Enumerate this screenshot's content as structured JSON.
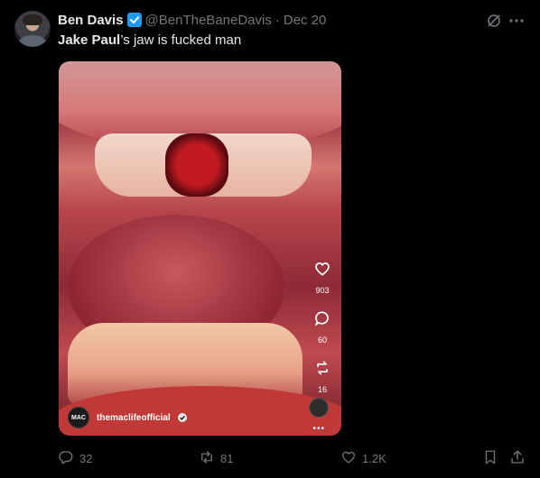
{
  "tweet": {
    "author_name": "Ben Davis",
    "handle": "@BenTheBaneDavis",
    "separator": "·",
    "date": "Dec 20",
    "mention": "Jake Paul",
    "text_rest": "’s jaw is fucked man"
  },
  "media": {
    "likes": "903",
    "comments": "60",
    "reposts": "16",
    "creator": "themaclifeofficial",
    "creator_logo": "MAC",
    "more": "•••"
  },
  "actions": {
    "replies": "32",
    "reposts": "81",
    "likes": "1.2K"
  },
  "colors": {
    "background": "#000000",
    "text": "#e7e9ea",
    "muted": "#71767b",
    "verified": "#1d9bf0"
  },
  "icons": [
    "grok-icon",
    "more-icon",
    "verified-icon",
    "heart-icon",
    "comment-icon",
    "repost-icon",
    "reply-icon",
    "bookmark-icon",
    "share-icon"
  ]
}
